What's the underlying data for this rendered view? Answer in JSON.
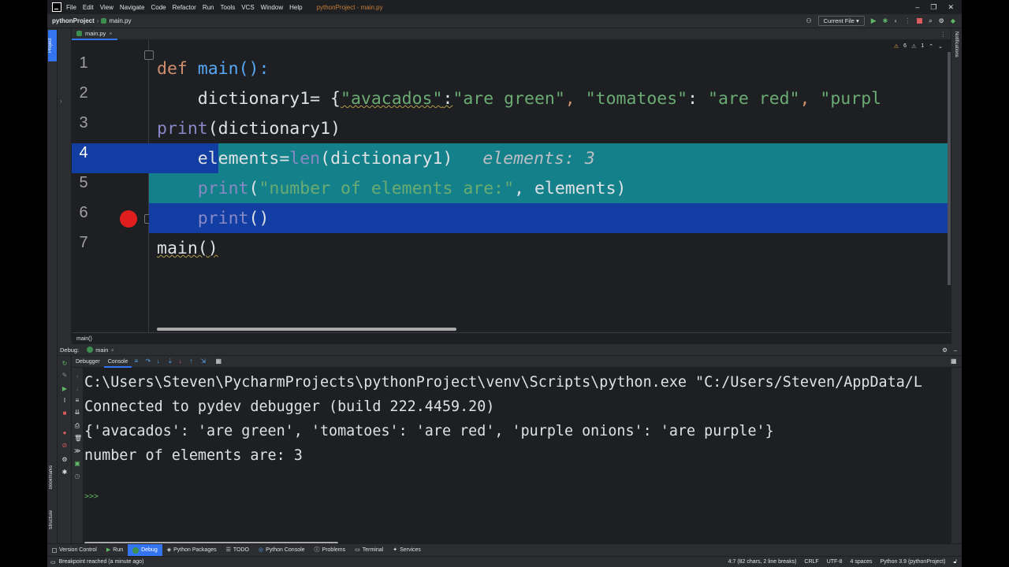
{
  "titlebar": {
    "menu": [
      "File",
      "Edit",
      "View",
      "Navigate",
      "Code",
      "Refactor",
      "Run",
      "Tools",
      "VCS",
      "Window",
      "Help"
    ],
    "window_title": "pythonProject - main.py"
  },
  "navbar": {
    "project": "pythonProject",
    "file": "main.py",
    "run_config": "Current File"
  },
  "left_strip": {
    "project_tab": "Project",
    "bookmarks": "Bookmarks",
    "structure": "Structure"
  },
  "right_strip": {
    "notifications": "Notifications"
  },
  "editor": {
    "tab_label": "main.py",
    "inspection": {
      "warnings": "6",
      "weak_warnings": "1"
    },
    "line_numbers": [
      "1",
      "2",
      "3",
      "4",
      "5",
      "6",
      "7"
    ],
    "lines": {
      "l1_kw": "def",
      "l1_rest": " main():",
      "l2_a": "    dictionary1= {",
      "l2_s1": "\"avacados\"",
      "l2_c1": ":",
      "l2_s2": "\"are green\"",
      "l2_c2": ", ",
      "l2_s3": "\"tomatoes\"",
      "l2_c3": ": ",
      "l2_s4": "\"are red\"",
      "l2_c4": ", ",
      "l2_s5": "\"purpl",
      "l3_fn": "print",
      "l3_rest": "(dictionary1)",
      "l4_a": "    elements=",
      "l4_fn": "len",
      "l4_rest": "(dictionary1)",
      "l4_hint": "elements: 3",
      "l5_fn": "print",
      "l5_p": "(",
      "l5_str": "\"number of elements are:\"",
      "l5_rest": ", elements)",
      "l6_fn": "print",
      "l6_rest": "()",
      "l7": "main()"
    },
    "breadcrumb": "main()"
  },
  "debug": {
    "label": "Debug:",
    "tab": "main",
    "subtabs": [
      "Debugger",
      "Console"
    ],
    "console_lines": [
      "C:\\Users\\Steven\\PycharmProjects\\pythonProject\\venv\\Scripts\\python.exe \"C:/Users/Steven/AppData/L",
      "Connected to pydev debugger (build 222.4459.20)",
      "{'avacados': 'are green', 'tomatoes': 'are red', 'purple onions': 'are purple'}",
      "number of elements are: 3"
    ],
    "prompt": ">>>"
  },
  "tool_windows": [
    "Version Control",
    "Run",
    "Debug",
    "Python Packages",
    "TODO",
    "Python Console",
    "Problems",
    "Terminal",
    "Services"
  ],
  "status": {
    "message": "Breakpoint reached (a minute ago)",
    "position": "4:7 (82 chars, 2 line breaks)",
    "line_sep": "CRLF",
    "encoding": "UTF-8",
    "indent": "4 spaces",
    "interpreter": "Python 3.9 (pythonProject)"
  }
}
